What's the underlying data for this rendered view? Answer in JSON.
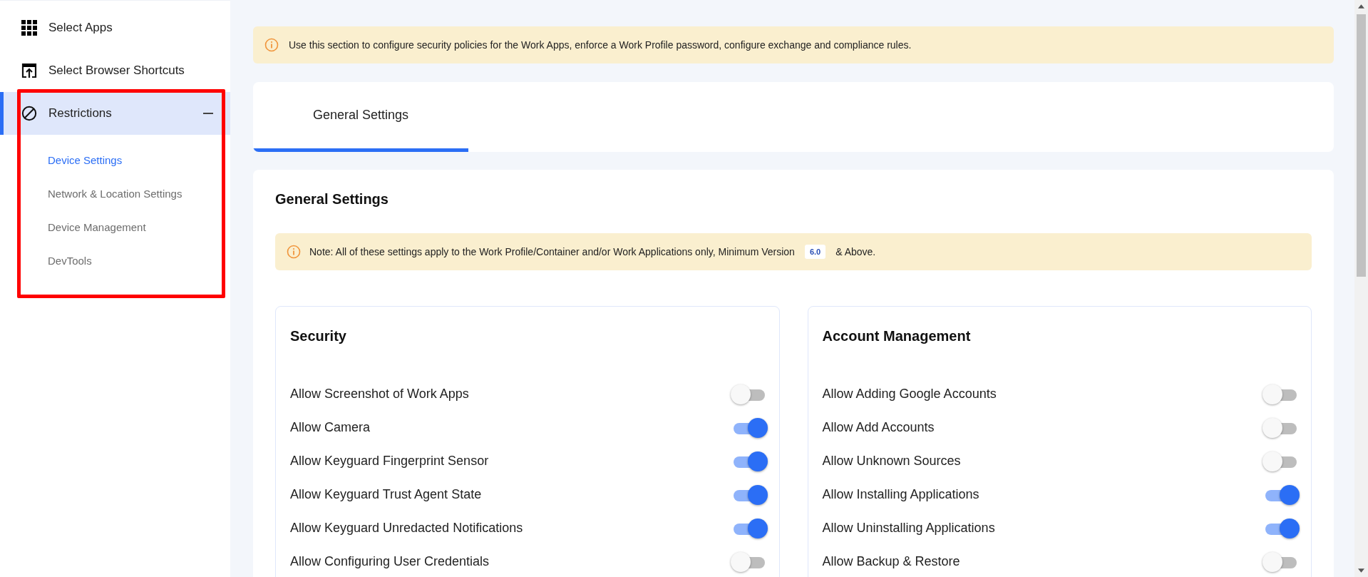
{
  "sidebar": {
    "items": [
      {
        "label": "Select Apps",
        "selected": false
      },
      {
        "label": "Select Browser Shortcuts",
        "selected": false
      },
      {
        "label": "Restrictions",
        "selected": true,
        "expanded": true,
        "children": [
          {
            "label": "Device Settings",
            "selected": true
          },
          {
            "label": "Network & Location Settings",
            "selected": false
          },
          {
            "label": "Device Management",
            "selected": false
          },
          {
            "label": "DevTools",
            "selected": false
          }
        ]
      }
    ]
  },
  "banner": {
    "text": "Use this section to configure security policies for the Work Apps, enforce a Work Profile password, configure exchange and compliance rules."
  },
  "tabs": [
    {
      "label": "General Settings",
      "selected": true
    }
  ],
  "section": {
    "title": "General Settings",
    "note": {
      "text": "Note: All of these settings apply to the Work Profile/Container and/or Work Applications only, Minimum Version",
      "version": "6.0",
      "suffix": "& Above."
    },
    "groups": [
      {
        "title": "Security",
        "settings": [
          {
            "label": "Allow Screenshot of Work Apps",
            "on": false
          },
          {
            "label": "Allow Camera",
            "on": true
          },
          {
            "label": "Allow Keyguard Fingerprint Sensor",
            "on": true
          },
          {
            "label": "Allow Keyguard Trust Agent State",
            "on": true
          },
          {
            "label": "Allow Keyguard Unredacted Notifications",
            "on": true
          },
          {
            "label": "Allow Configuring User Credentials",
            "on": false
          }
        ]
      },
      {
        "title": "Account Management",
        "settings": [
          {
            "label": "Allow Adding Google Accounts",
            "on": false
          },
          {
            "label": "Allow Add Accounts",
            "on": false
          },
          {
            "label": "Allow Unknown Sources",
            "on": false
          },
          {
            "label": "Allow Installing Applications",
            "on": true
          },
          {
            "label": "Allow Uninstalling Applications",
            "on": true
          },
          {
            "label": "Allow Backup & Restore",
            "on": false
          }
        ]
      }
    ]
  }
}
